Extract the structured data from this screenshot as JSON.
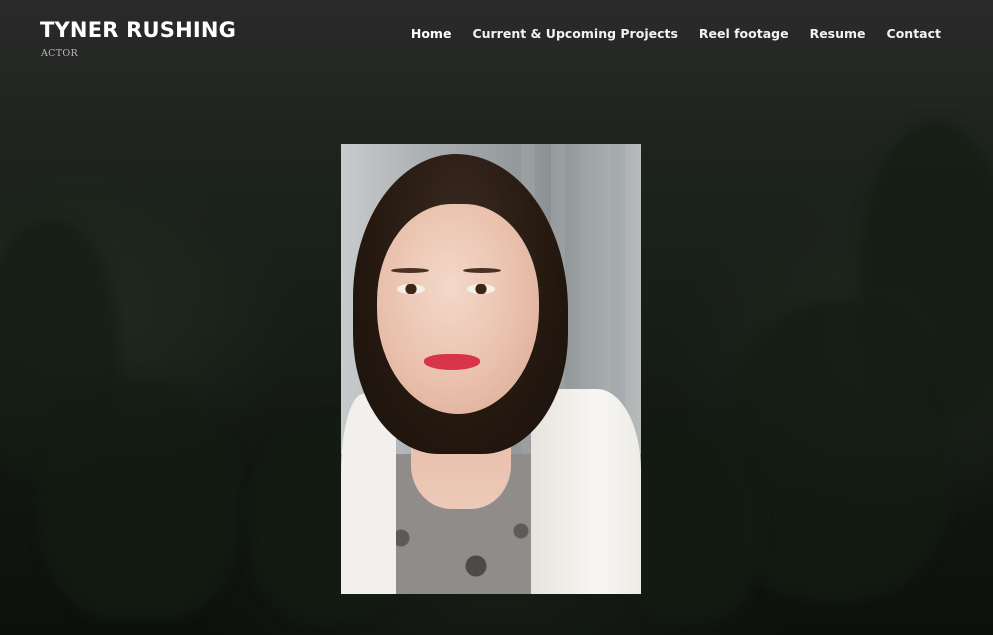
{
  "site": {
    "title": "TYNER RUSHING",
    "tagline": "ACTOR"
  },
  "nav": {
    "items": [
      {
        "label": "Home",
        "active": true
      },
      {
        "label": "Current & Upcoming Projects",
        "active": false
      },
      {
        "label": "Reel footage",
        "active": false
      },
      {
        "label": "Resume",
        "active": false
      },
      {
        "label": "Contact",
        "active": false
      }
    ]
  },
  "hero": {
    "image_alt": "Headshot portrait"
  },
  "colors": {
    "text_primary": "#ffffff",
    "tagline": "#b9b9b9",
    "background": "#121411"
  }
}
